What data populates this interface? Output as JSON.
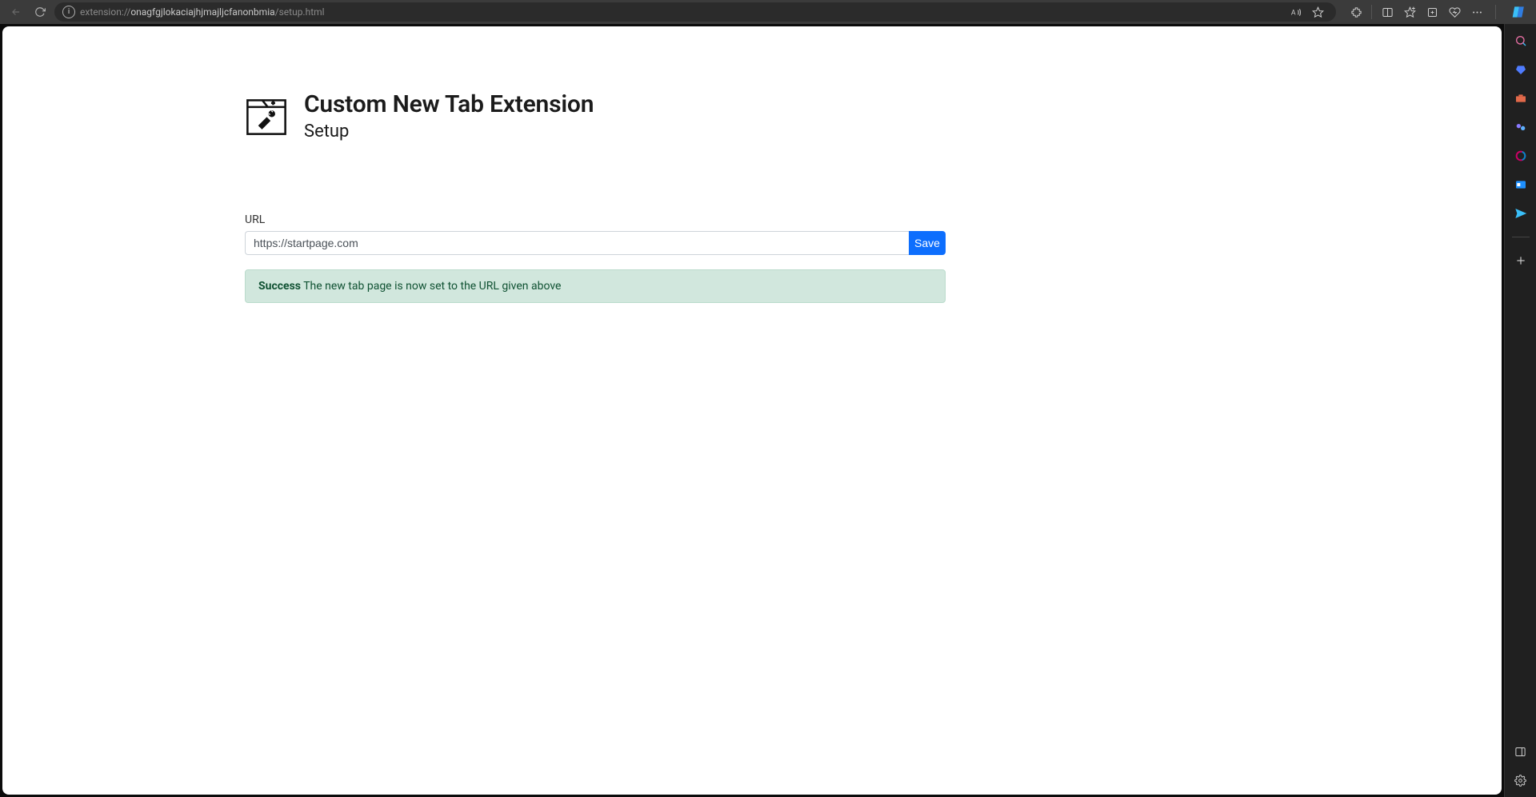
{
  "address_bar": {
    "prefix": "extension://",
    "host": "onagfgjlokaciajhjmajljcfanonbmia",
    "suffix": "/setup.html"
  },
  "page": {
    "title": "Custom New Tab Extension",
    "subtitle": "Setup"
  },
  "form": {
    "url_label": "URL",
    "url_value": "https://startpage.com",
    "save_label": "Save"
  },
  "alert": {
    "strong": "Success",
    "message": " The new tab page is now set to the URL given above"
  },
  "icons": {
    "back": "back-icon",
    "refresh": "refresh-icon",
    "info": "info-icon",
    "read_aloud": "read-aloud-icon",
    "star": "star-icon",
    "extensions": "extensions-icon",
    "split": "split-screen-icon",
    "favorites": "favorites-icon",
    "collections": "collections-icon",
    "performance": "performance-icon",
    "more": "more-icon",
    "copilot": "copilot-icon"
  },
  "sidebar": {
    "search": "search-icon",
    "shopping": "shopping-icon",
    "tools": "tools-icon",
    "games": "games-icon",
    "m365": "m365-icon",
    "outlook": "outlook-icon",
    "drop": "drop-icon",
    "plus": "plus-icon",
    "hide": "hide-sidebar-icon",
    "settings": "settings-icon"
  }
}
